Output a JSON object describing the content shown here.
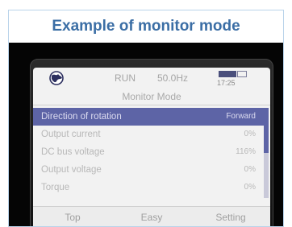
{
  "caption": "Example of monitor mode",
  "status": {
    "icon": "globe-icon",
    "run": "RUN",
    "frequency": "50.0Hz",
    "time": "17:25"
  },
  "mode_title": "Monitor Mode",
  "rows": [
    {
      "label": "Direction of rotation",
      "value": "Forward",
      "selected": true
    },
    {
      "label": "Output current",
      "value": "0%"
    },
    {
      "label": "DC bus voltage",
      "value": "116%"
    },
    {
      "label": "Output voltage",
      "value": "0%"
    },
    {
      "label": "Torque",
      "value": "0%"
    }
  ],
  "softkeys": [
    "Top",
    "Easy",
    "Setting"
  ],
  "colors": {
    "caption_text": "#3b6ea5",
    "selection": "#5d64a6",
    "lcd_background": "#f2f2f2"
  }
}
